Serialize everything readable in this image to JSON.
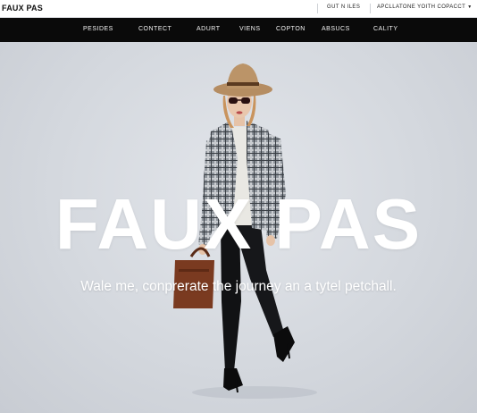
{
  "brand": {
    "name": "FAUX PAS"
  },
  "top_links": [
    {
      "label": "GUT N ILES"
    },
    {
      "label": "APCLLATONE YOITH COPACCT"
    }
  ],
  "main_nav": [
    {
      "label": "PESIDES"
    },
    {
      "label": "CONTECT"
    },
    {
      "label": "ADURT"
    },
    {
      "label": "VIENS"
    },
    {
      "label": "COPTON"
    },
    {
      "label": "ABSUCS"
    },
    {
      "label": "CALITY"
    }
  ],
  "hero": {
    "title": "FAUX PAS",
    "subtitle": "Wale me, conprerate the journey an a tytel petchall."
  },
  "icons": {
    "dropdown": "chevron-down-icon"
  },
  "colors": {
    "nav_background": "#0a0a0a",
    "topbar_background": "#ffffff",
    "hero_background": "#d4d8de",
    "hero_text": "#ffffff"
  }
}
